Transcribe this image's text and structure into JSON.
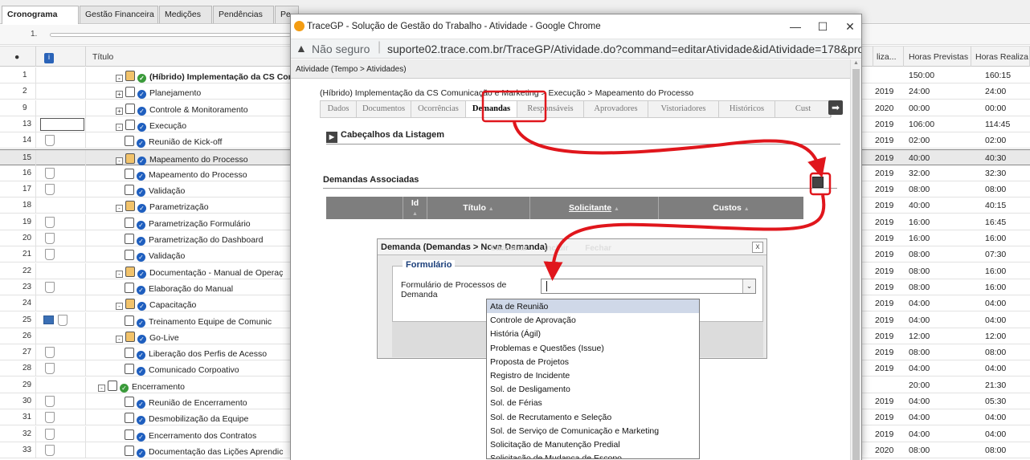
{
  "tabs": [
    {
      "label": "Cronograma"
    },
    {
      "label": "Gestão Financeira"
    },
    {
      "label": "Medições"
    },
    {
      "label": "Pendências"
    },
    {
      "label": "Pe"
    }
  ],
  "level": "1.",
  "columns": {
    "title": "Título",
    "col_a": "liza...",
    "horas_previstas": "Horas Previstas",
    "horas_realizadas": "Horas Realiza"
  },
  "rows": [
    {
      "n": "1",
      "title": "(Híbrido) Implementação da CS Com",
      "a": "",
      "p": "150:00",
      "r": "160:15"
    },
    {
      "n": "2",
      "title": "Planejamento",
      "a": "2019",
      "p": "24:00",
      "r": "24:00"
    },
    {
      "n": "9",
      "title": "Controle & Monitoramento",
      "a": "2020",
      "p": "00:00",
      "r": "00:00"
    },
    {
      "n": "13",
      "title": "Execução",
      "a": "2019",
      "p": "106:00",
      "r": "114:45"
    },
    {
      "n": "14",
      "title": "Reunião de Kick-off",
      "a": "2019",
      "p": "02:00",
      "r": "02:00"
    },
    {
      "n": "15",
      "title": "Mapeamento do Processo",
      "a": "2019",
      "p": "40:00",
      "r": "40:30"
    },
    {
      "n": "16",
      "title": "Mapeamento do Processo",
      "a": "2019",
      "p": "32:00",
      "r": "32:30"
    },
    {
      "n": "17",
      "title": "Validação",
      "a": "2019",
      "p": "08:00",
      "r": "08:00"
    },
    {
      "n": "18",
      "title": "Parametrização",
      "a": "2019",
      "p": "40:00",
      "r": "40:15"
    },
    {
      "n": "19",
      "title": "Parametrização Formulário",
      "a": "2019",
      "p": "16:00",
      "r": "16:45"
    },
    {
      "n": "20",
      "title": "Parametrização do Dashboard",
      "a": "2019",
      "p": "16:00",
      "r": "16:00"
    },
    {
      "n": "21",
      "title": "Validação",
      "a": "2019",
      "p": "08:00",
      "r": "07:30"
    },
    {
      "n": "22",
      "title": "Documentação - Manual de Operaç",
      "a": "2019",
      "p": "08:00",
      "r": "16:00"
    },
    {
      "n": "23",
      "title": "Elaboração do Manual",
      "a": "2019",
      "p": "08:00",
      "r": "16:00"
    },
    {
      "n": "24",
      "title": "Capacitação",
      "a": "2019",
      "p": "04:00",
      "r": "04:00"
    },
    {
      "n": "25",
      "title": "Treinamento Equipe de Comunic",
      "a": "2019",
      "p": "04:00",
      "r": "04:00"
    },
    {
      "n": "26",
      "title": "Go-Live",
      "a": "2019",
      "p": "12:00",
      "r": "12:00"
    },
    {
      "n": "27",
      "title": "Liberação dos Perfis de Acesso",
      "a": "2019",
      "p": "08:00",
      "r": "08:00"
    },
    {
      "n": "28",
      "title": "Comunicado Corpoativo",
      "a": "2019",
      "p": "04:00",
      "r": "04:00"
    },
    {
      "n": "29",
      "title": "Encerramento",
      "a": "",
      "p": "20:00",
      "r": "21:30"
    },
    {
      "n": "30",
      "title": "Reunião de Encerramento",
      "a": "2019",
      "p": "04:00",
      "r": "05:30"
    },
    {
      "n": "31",
      "title": "Desmobilização da Equipe",
      "a": "2019",
      "p": "04:00",
      "r": "04:00"
    },
    {
      "n": "32",
      "title": "Encerramento dos Contratos",
      "a": "2019",
      "p": "04:00",
      "r": "04:00"
    },
    {
      "n": "33",
      "title": "Documentação das Lições Aprendic",
      "a": "2020",
      "p": "08:00",
      "r": "08:00"
    }
  ],
  "popup": {
    "title": "TraceGP - Solução de Gestão do Trabalho - Atividade - Google Chrome",
    "not_secure": "Não seguro",
    "url": "suporte02.trace.com.br/TraceGP/Atividade.do?command=editarAtividade&idAtividade=178&projet...",
    "crumb": "Atividade (Tempo > Atividades)",
    "path": "(Híbrido) Implementação da CS Comunicação e Marketing > Execução > Mapeamento do Processo",
    "tabs": [
      "Dados",
      "Documentos",
      "Ocorrências",
      "Demandas",
      "Responsáveis",
      "Aprovadores",
      "Vistoriadores",
      "Históricos",
      "Cust"
    ],
    "cabecalhos": "Cabeçalhos da Listagem",
    "demandas": "Demandas Associadas",
    "grid": {
      "id": "Id",
      "titulo": "Título",
      "solicitante": "Solicitante",
      "custos": "Custos"
    }
  },
  "modal": {
    "title": "Demanda (Demandas > Nova Demanda)",
    "ghost": "Cadastrar Incluir Fechar",
    "close": "x",
    "legend": "Formulário",
    "label": "Formulário de Processos de Demanda",
    "options": [
      "Ata de Reunião",
      "Controle de Aprovação",
      "História (Ágil)",
      "Problemas e Questões (Issue)",
      "Proposta de Projetos",
      "Registro de Incidente",
      "Sol. de Desligamento",
      "Sol. de Férias",
      "Sol. de Recrutamento e Seleção",
      "Sol. de Serviço de Comunicação e Marketing",
      "Solicitação de Manutenção Predial",
      "Solicitação de Mudança de Escopo"
    ]
  }
}
